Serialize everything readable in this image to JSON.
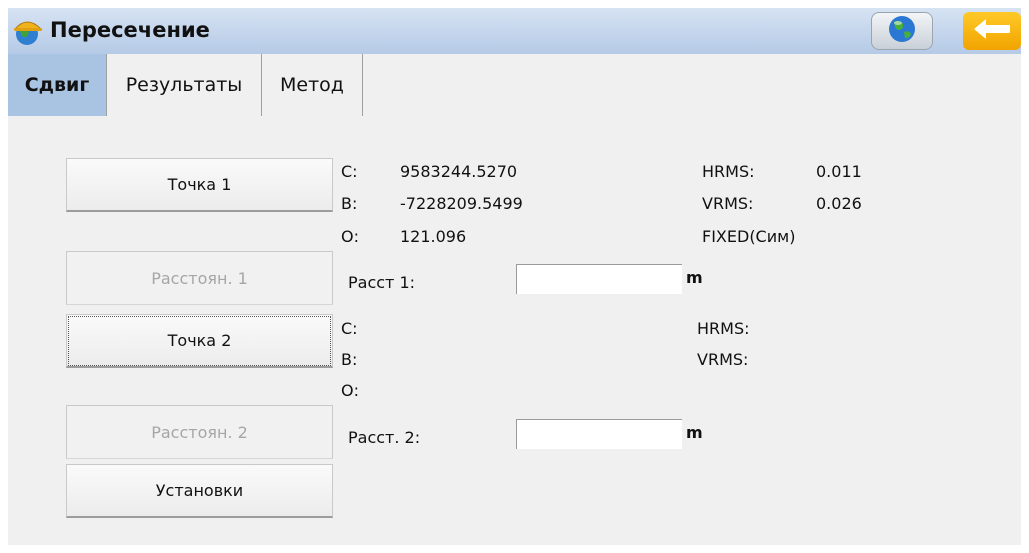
{
  "title": "Пересечение",
  "header_icons": {
    "app": "hardhat-globe-icon",
    "globe": "globe-icon",
    "back": "back-arrow-icon"
  },
  "tabs": [
    {
      "label": "Сдвиг",
      "active": true
    },
    {
      "label": "Результаты",
      "active": false
    },
    {
      "label": "Метод",
      "active": false
    }
  ],
  "buttons": {
    "point1": "Точка 1",
    "distance1": "Расстоян. 1",
    "point2": "Точка 2",
    "distance2": "Расстоян. 2",
    "settings": "Установки"
  },
  "point1": {
    "c_label": "С:",
    "c_value": "9583244.5270",
    "b_label": "В:",
    "b_value": "-7228209.5499",
    "o_label": "О:",
    "o_value": "121.096",
    "hrms_label": "HRMS:",
    "hrms_value": "0.011",
    "vrms_label": "VRMS:",
    "vrms_value": "0.026",
    "status": "FIXED(Сим)"
  },
  "dist1": {
    "label": "Расст 1:",
    "value": "",
    "unit": "m"
  },
  "point2": {
    "c_label": "С:",
    "b_label": "В:",
    "o_label": "О:",
    "hrms_label": "HRMS:",
    "vrms_label": "VRMS:"
  },
  "dist2": {
    "label": "Расст. 2:",
    "value": "",
    "unit": "m"
  },
  "colors": {
    "active_tab": "#a9c3e2",
    "back_button": "#f5b400",
    "background": "#f0f0f0"
  }
}
